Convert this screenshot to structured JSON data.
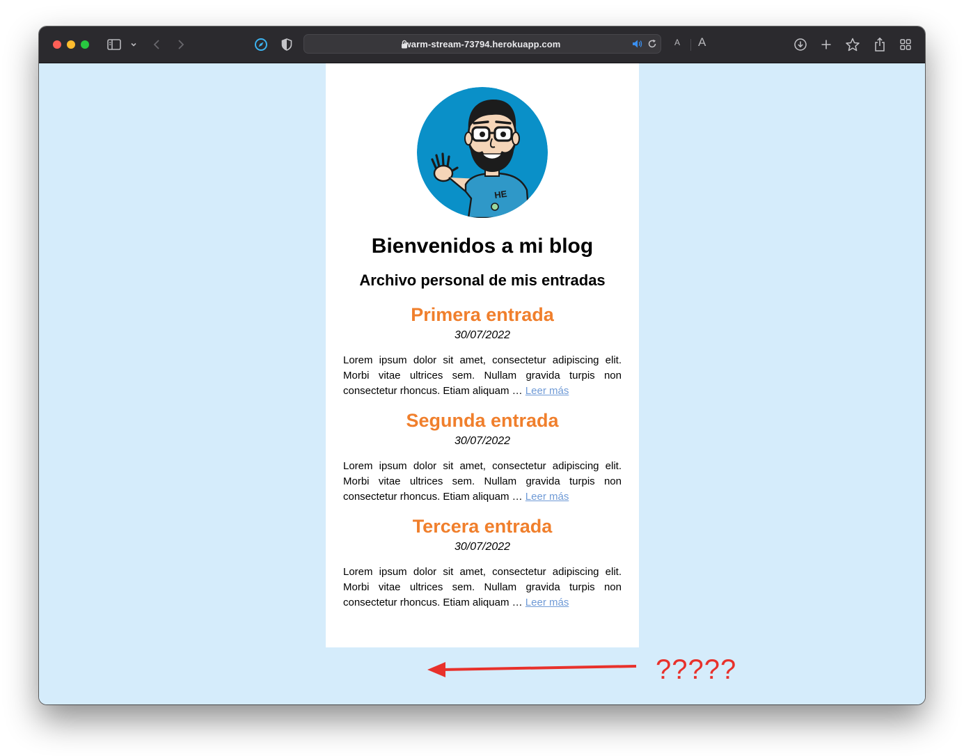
{
  "browser": {
    "url": "warm-stream-73794.herokuapp.com",
    "reader_small": "A",
    "reader_large": "A",
    "icons": [
      "sidebar-icon",
      "chevron-down-icon",
      "back-icon",
      "forward-icon",
      "compass-icon",
      "shield-icon",
      "lock-icon",
      "speaker-icon",
      "reload-icon",
      "download-icon",
      "plus-icon",
      "star-icon",
      "share-icon",
      "tabs-grid-icon"
    ]
  },
  "blog": {
    "title": "Bienvenidos a mi blog",
    "subtitle": "Archivo personal de mis entradas",
    "posts": [
      {
        "title": "Primera entrada",
        "date": "30/07/2022",
        "excerpt": "Lorem ipsum dolor sit amet, consectetur adipiscing elit. Morbi vitae ultrices sem. Nullam gravida turpis non consectetur rhoncus. Etiam aliquam … ",
        "read_more": "Leer más"
      },
      {
        "title": "Segunda entrada",
        "date": "30/07/2022",
        "excerpt": "Lorem ipsum dolor sit amet, consectetur adipiscing elit. Morbi vitae ultrices sem. Nullam gravida turpis non consectetur rhoncus. Etiam aliquam … ",
        "read_more": "Leer más"
      },
      {
        "title": "Tercera entrada",
        "date": "30/07/2022",
        "excerpt": "Lorem ipsum dolor sit amet, consectetur adipiscing elit. Morbi vitae ultrices sem. Nullam gravida turpis non consectetur rhoncus. Etiam aliquam … ",
        "read_more": "Leer más"
      }
    ]
  },
  "annotation": {
    "text": "?????"
  },
  "colors": {
    "page_background": "#d5ecfb",
    "post_title": "#f07f2c",
    "link": "#6f9ad6",
    "annotation": "#e8312b",
    "avatar_background": "#0a90c8"
  }
}
